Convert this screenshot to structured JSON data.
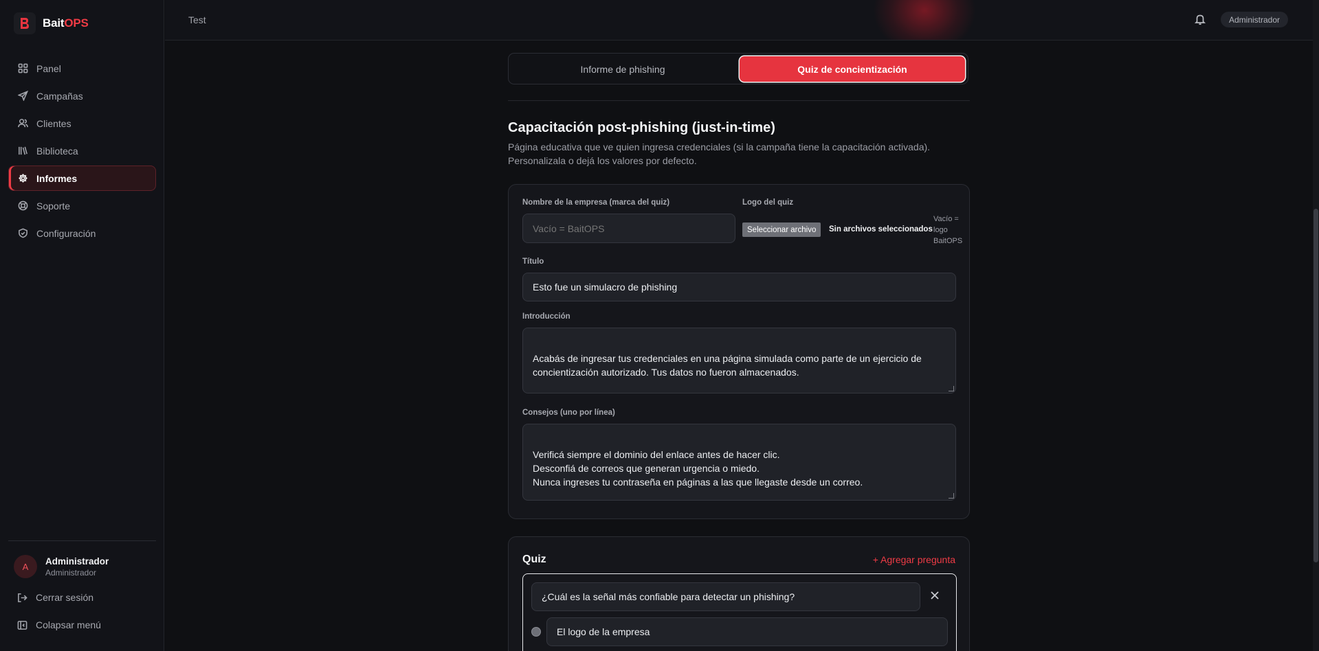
{
  "app": {
    "brand_main": "Bait",
    "brand_accent": "OPS",
    "accent_color": "#ef3b45"
  },
  "sidebar": {
    "items": [
      {
        "label": "Panel",
        "icon": "grid-icon"
      },
      {
        "label": "Campañas",
        "icon": "send-icon"
      },
      {
        "label": "Clientes",
        "icon": "users-icon"
      },
      {
        "label": "Biblioteca",
        "icon": "library-icon"
      },
      {
        "label": "Informes",
        "icon": "gear-icon",
        "active": true
      },
      {
        "label": "Soporte",
        "icon": "lifebuoy-icon"
      },
      {
        "label": "Configuración",
        "icon": "shield-icon"
      }
    ],
    "user": {
      "initial": "A",
      "name": "Administrador",
      "role": "Administrador"
    },
    "logout_label": "Cerrar sesión",
    "collapse_label": "Colapsar menú"
  },
  "topbar": {
    "breadcrumb": "Test",
    "role_badge": "Administrador"
  },
  "tabs": [
    {
      "label": "Informe de phishing",
      "active": false
    },
    {
      "label": "Quiz de concientización",
      "active": true
    }
  ],
  "section": {
    "title": "Capacitación post-phishing (just-in-time)",
    "description_line1": "Página educativa que ve quien ingresa credenciales (si la campaña tiene la capacitación activada).",
    "description_line2": "Personalizala o dejá los valores por defecto."
  },
  "form": {
    "company_label": "Nombre de la empresa (marca del quiz)",
    "company_placeholder": "Vacío = BaitOPS",
    "logo_label": "Logo del quiz",
    "logo_button": "Seleccionar archivo",
    "logo_status": "Sin archivos seleccionados",
    "logo_hint": "Vacío = logo BaitOPS",
    "title_label": "Título",
    "title_value": "Esto fue un simulacro de phishing",
    "intro_label": "Introducción",
    "intro_value": "Acabás de ingresar tus credenciales en una página simulada como parte de un ejercicio de concientización autorizado. Tus datos no fueron almacenados.",
    "tips_label": "Consejos (uno por línea)",
    "tips_value": "Verificá siempre el dominio del enlace antes de hacer clic.\nDesconfiá de correos que generan urgencia o miedo.\nNunca ingreses tu contraseña en páginas a las que llegaste desde un correo."
  },
  "quiz": {
    "title": "Quiz",
    "add_label": "+ Agregar pregunta",
    "question": "¿Cuál es la señal más confiable para detectar un phishing?",
    "options": [
      "El logo de la empresa"
    ]
  }
}
